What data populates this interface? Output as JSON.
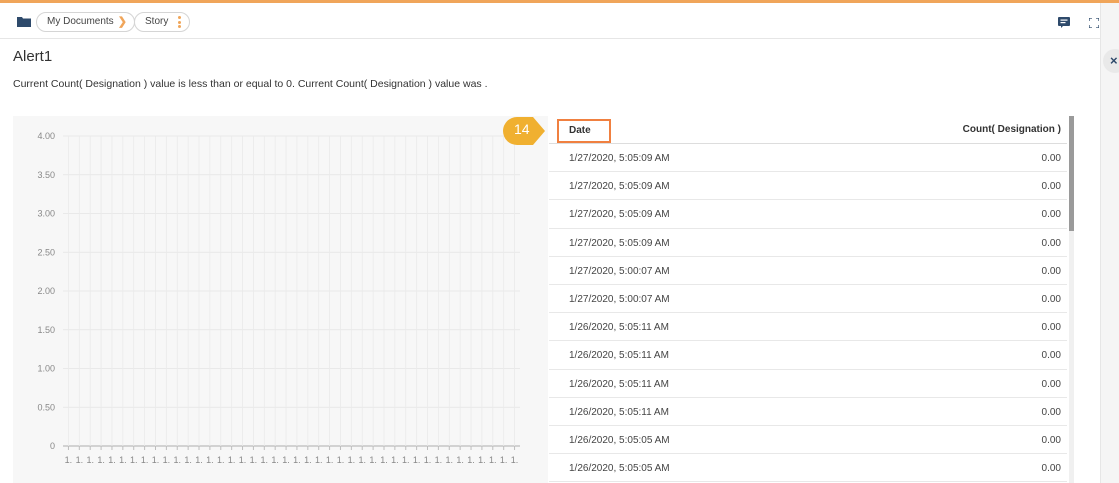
{
  "breadcrumb": {
    "items": [
      "My Documents",
      "Story"
    ],
    "separator": "❯"
  },
  "icons": {
    "folder": "folder-icon",
    "chat": "chat-icon",
    "expand": "expand-icon",
    "close": "close-icon",
    "kebab": "kebab-menu-icon"
  },
  "close_label": "×",
  "alert": {
    "title": "Alert1",
    "description": "Current Count( Designation ) value is less than or equal to 0. Current Count( Designation ) value was ."
  },
  "step_badge": "14",
  "colors": {
    "accent": "#f0a55a",
    "badge": "#f0b030",
    "highlight_box": "#f08040"
  },
  "chart_data": {
    "type": "bar",
    "yticks": [
      "4.00",
      "3.50",
      "3.00",
      "2.50",
      "2.00",
      "1.50",
      "1.00",
      "0.50",
      "0"
    ],
    "ylim": [
      0,
      4
    ],
    "x_tick_label": "1.",
    "x_tick_count": 42,
    "values": [
      0,
      0,
      0,
      0,
      0,
      0,
      0,
      0,
      0,
      0,
      0,
      0,
      0,
      0,
      0,
      0,
      0,
      0,
      0,
      0,
      0,
      0,
      0,
      0,
      0,
      0,
      0,
      0,
      0,
      0,
      0,
      0,
      0,
      0,
      0,
      0,
      0,
      0,
      0,
      0,
      0,
      0
    ],
    "grid": true
  },
  "table": {
    "columns": [
      "Date",
      "Count( Designation )"
    ],
    "rows": [
      [
        "1/27/2020, 5:05:09 AM",
        "0.00"
      ],
      [
        "1/27/2020, 5:05:09 AM",
        "0.00"
      ],
      [
        "1/27/2020, 5:05:09 AM",
        "0.00"
      ],
      [
        "1/27/2020, 5:05:09 AM",
        "0.00"
      ],
      [
        "1/27/2020, 5:00:07 AM",
        "0.00"
      ],
      [
        "1/27/2020, 5:00:07 AM",
        "0.00"
      ],
      [
        "1/26/2020, 5:05:11 AM",
        "0.00"
      ],
      [
        "1/26/2020, 5:05:11 AM",
        "0.00"
      ],
      [
        "1/26/2020, 5:05:11 AM",
        "0.00"
      ],
      [
        "1/26/2020, 5:05:11 AM",
        "0.00"
      ],
      [
        "1/26/2020, 5:05:05 AM",
        "0.00"
      ],
      [
        "1/26/2020, 5:05:05 AM",
        "0.00"
      ]
    ]
  }
}
